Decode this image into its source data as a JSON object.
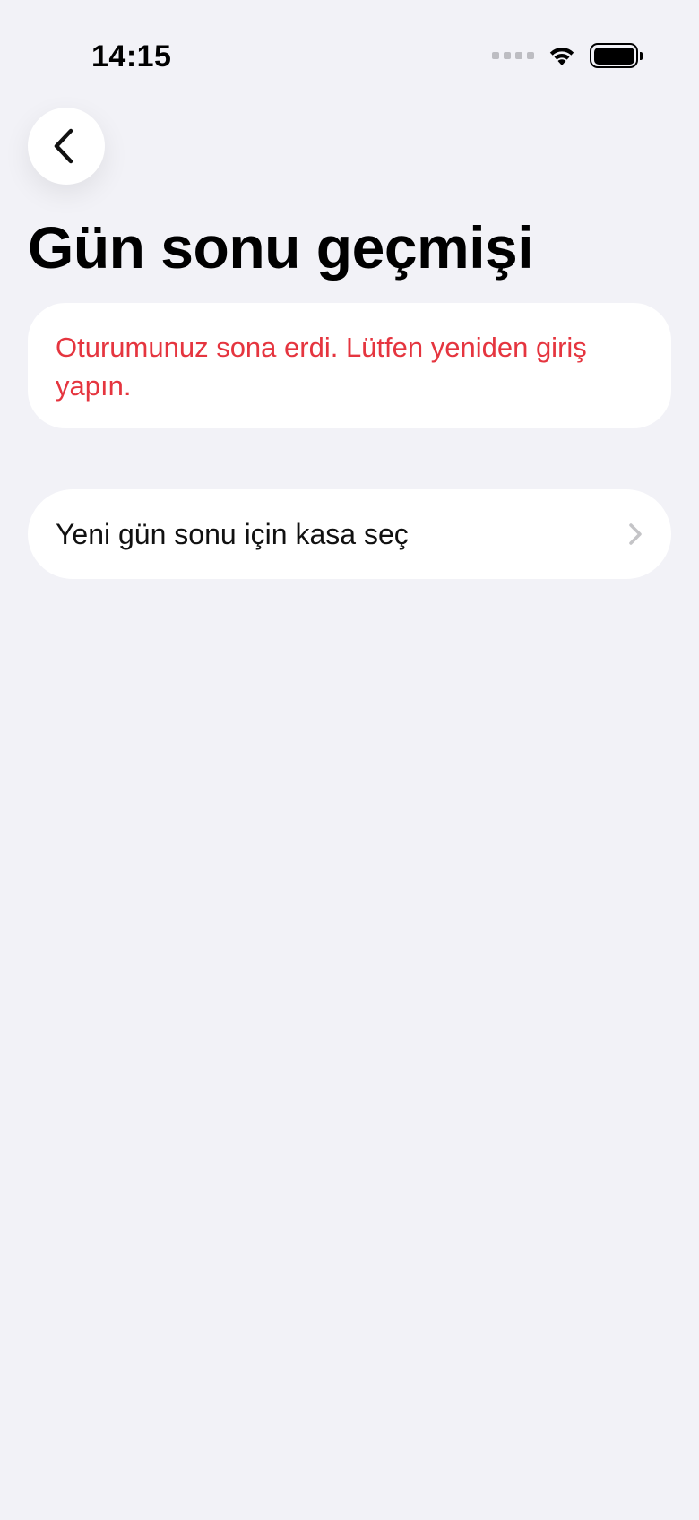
{
  "status_bar": {
    "time": "14:15",
    "icons": [
      "signal-icon",
      "wifi-icon",
      "battery-icon"
    ]
  },
  "nav": {
    "back_icon": "chevron-left-icon"
  },
  "page": {
    "title": "Gün sonu geçmişi"
  },
  "error": {
    "message": "Oturumunuz sona erdi. Lütfen yeniden giriş yapın.",
    "color": "#E5353F"
  },
  "actions": {
    "select_register_label": "Yeni gün sonu için kasa seç",
    "chevron_icon": "chevron-right-icon"
  },
  "colors": {
    "background": "#F2F2F7",
    "card": "#FFFFFF",
    "text": "#000000"
  }
}
